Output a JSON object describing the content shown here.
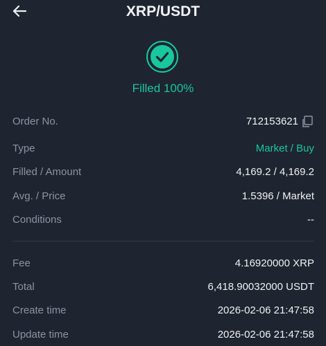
{
  "header": {
    "title": "XRP/USDT",
    "back_icon": "arrow-left-icon"
  },
  "status": {
    "icon": "check-circle-icon",
    "text": "Filled 100%",
    "color": "#19c79f"
  },
  "order_details": {
    "order_no_label": "Order No.",
    "order_no_value": "712153621",
    "copy_icon": "copy-icon",
    "type_label": "Type",
    "type_value": "Market / Buy",
    "filled_label": "Filled / Amount",
    "filled_value": "4,169.2 / 4,169.2",
    "avg_label": "Avg. / Price",
    "avg_value": "1.5396 / Market",
    "conditions_label": "Conditions",
    "conditions_value": "--"
  },
  "fee_details": {
    "fee_label": "Fee",
    "fee_value": "4.16920000 XRP",
    "total_label": "Total",
    "total_value": "6,418.90032000 USDT",
    "create_label": "Create time",
    "create_value": "2026-02-06 21:47:58",
    "update_label": "Update time",
    "update_value": "2026-02-06 21:47:58"
  },
  "colors": {
    "background": "#1f2530",
    "accent_green": "#19c79f",
    "label_gray": "#8b93a1",
    "value_white": "#eef0f3"
  }
}
